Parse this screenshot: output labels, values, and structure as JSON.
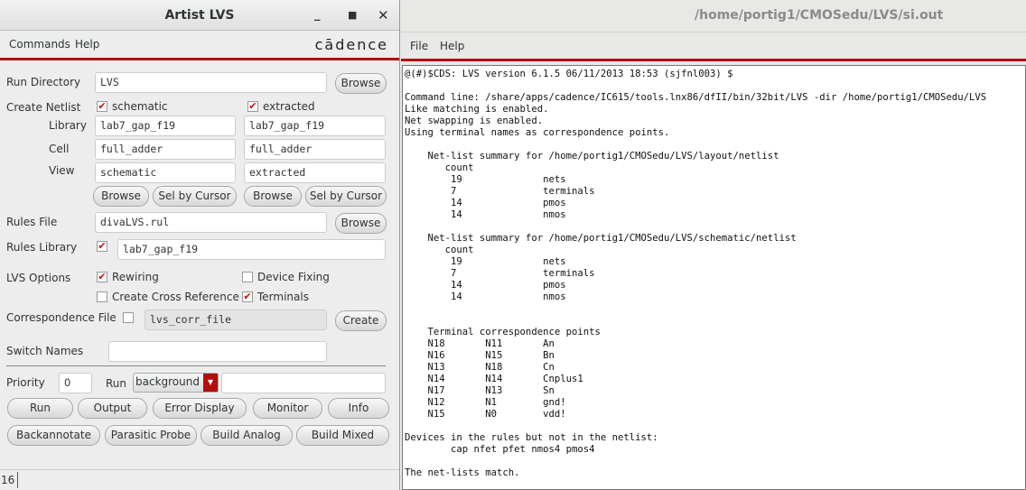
{
  "left_window": {
    "title": "Artist LVS",
    "menu": [
      "Commands",
      "Help"
    ],
    "logo": "cādence",
    "run_directory": {
      "label": "Run Directory",
      "value": "LVS",
      "browse": "Browse"
    },
    "create_netlist": {
      "label": "Create Netlist",
      "schematic": "schematic",
      "extracted": "extracted",
      "schematic_checked": true,
      "extracted_checked": true
    },
    "library": {
      "label": "Library",
      "schematic": "lab7_gap_f19",
      "extracted": "lab7_gap_f19"
    },
    "cell": {
      "label": "Cell",
      "schematic": "full_adder",
      "extracted": "full_adder"
    },
    "view": {
      "label": "View",
      "schematic": "schematic",
      "extracted": "extracted"
    },
    "browse": "Browse",
    "sel_by_cursor": "Sel by Cursor",
    "rules_file": {
      "label": "Rules File",
      "value": "divaLVS.rul",
      "browse": "Browse"
    },
    "rules_library": {
      "label": "Rules Library",
      "value": "lab7_gap_f19",
      "checked": true
    },
    "lvs_options": {
      "label": "LVS Options",
      "rewiring": "Rewiring",
      "device_fixing": "Device Fixing",
      "cross_ref": "Create Cross Reference",
      "terminals": "Terminals"
    },
    "correspondence": {
      "label": "Correspondence File",
      "value": "lvs_corr_file",
      "create": "Create"
    },
    "switch_names": {
      "label": "Switch Names",
      "value": ""
    },
    "priority": {
      "label": "Priority",
      "value": "0"
    },
    "run": {
      "label": "Run",
      "mode": "background"
    },
    "buttons1": [
      "Run",
      "Output",
      "Error Display",
      "Monitor",
      "Info"
    ],
    "buttons2": [
      "Backannotate",
      "Parasitic Probe",
      "Build Analog",
      "Build Mixed"
    ],
    "status": "16"
  },
  "right_window": {
    "title": "/home/portig1/CMOSedu/LVS/si.out",
    "menu": [
      "File",
      "Help"
    ],
    "log": "@(#)$CDS: LVS version 6.1.5 06/11/2013 18:53 (sjfnl003) $\n\nCommand line: /share/apps/cadence/IC615/tools.lnx86/dfII/bin/32bit/LVS -dir /home/portig1/CMOSedu/LVS\nLike matching is enabled.\nNet swapping is enabled.\nUsing terminal names as correspondence points.\n\n    Net-list summary for /home/portig1/CMOSedu/LVS/layout/netlist\n       count\n        19              nets\n        7               terminals\n        14              pmos\n        14              nmos\n\n    Net-list summary for /home/portig1/CMOSedu/LVS/schematic/netlist\n       count\n        19              nets\n        7               terminals\n        14              pmos\n        14              nmos\n\n\n    Terminal correspondence points\n    N18       N11       An\n    N16       N15       Bn\n    N13       N18       Cn\n    N14       N14       Cnplus1\n    N17       N13       Sn\n    N12       N1        gnd!\n    N15       N0        vdd!\n\nDevices in the rules but not in the netlist:\n        cap nfet pfet nmos4 pmos4\n\nThe net-lists match."
  }
}
